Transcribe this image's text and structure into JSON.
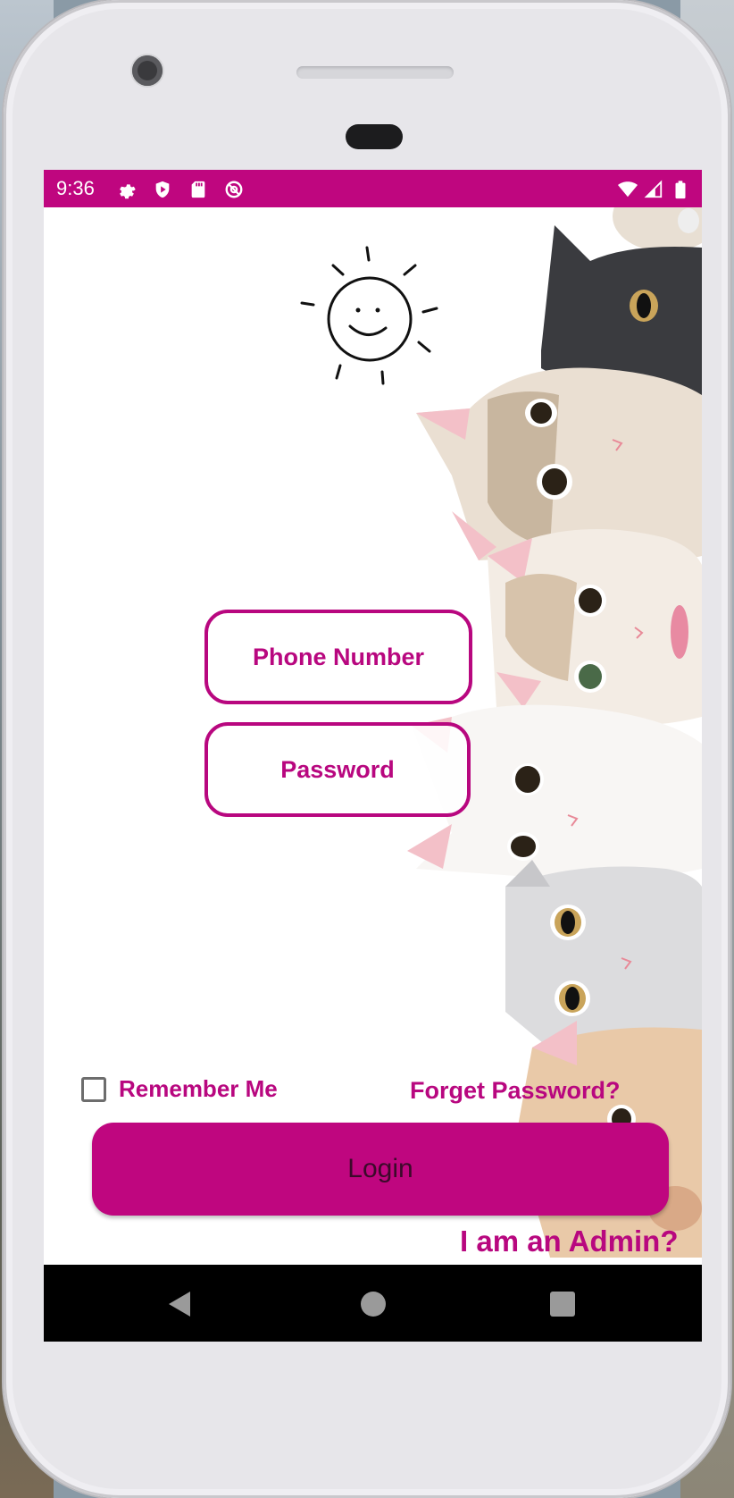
{
  "status_bar": {
    "time": "9:36",
    "left_icons": [
      "settings-icon",
      "shield-play-icon",
      "sd-card-icon",
      "at-sign-icon"
    ],
    "right_icons": [
      "wifi-icon",
      "cell-signal-icon",
      "battery-icon"
    ],
    "color": "#bf067f"
  },
  "form": {
    "phone_placeholder": "Phone Number",
    "password_placeholder": "Password",
    "remember_label": "Remember Me",
    "remember_checked": false,
    "forget_label": "Forget Password?",
    "login_label": "Login",
    "admin_label": "I am an Admin?"
  },
  "decor": {
    "sun": "smiling-sun-doodle",
    "background": "cats-illustration"
  },
  "nav_bar": {
    "buttons": [
      "back-icon",
      "home-icon",
      "recents-icon"
    ]
  },
  "colors": {
    "accent": "#b8077f",
    "button": "#bf067f"
  }
}
